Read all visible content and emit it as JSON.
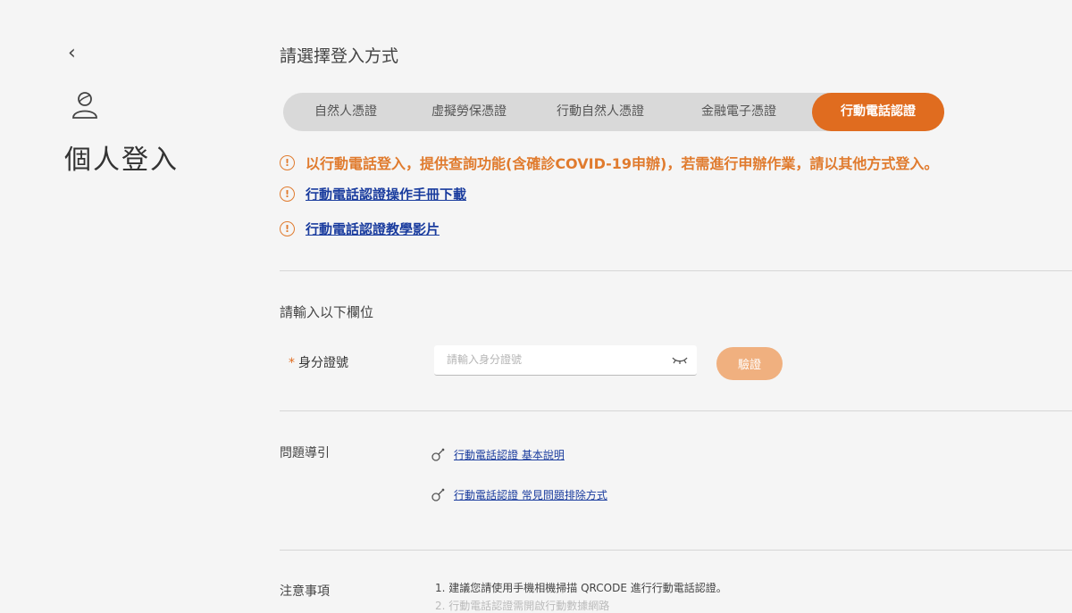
{
  "nav": {
    "back_symbol": "‹",
    "title": "個人登入"
  },
  "login": {
    "heading": "請選擇登入方式",
    "tabs": [
      {
        "label": "自然人憑證",
        "active": false
      },
      {
        "label": "虛擬勞保憑證",
        "active": false
      },
      {
        "label": "行動自然人憑證",
        "active": false
      },
      {
        "label": "金融電子憑證",
        "active": false
      },
      {
        "label": "行動電話認證",
        "active": true
      }
    ],
    "notices": [
      {
        "type": "text",
        "text": "以行動電話登入，提供查詢功能(含確診COVID-19申辦)，若需進行申辦作業，請以其他方式登入。"
      },
      {
        "type": "link",
        "text": "行動電話認證操作手冊下載"
      },
      {
        "type": "link",
        "text": "行動電話認證教學影片"
      }
    ]
  },
  "form": {
    "heading": "請輸入以下欄位",
    "required_mark": "*",
    "id_label": "身分證號",
    "id_value": "",
    "id_placeholder": "請輸入身分證號",
    "verify_label": "驗證"
  },
  "guide": {
    "label": "問題導引",
    "links": [
      "行動電話認證 基本說明",
      "行動電話認證 常見問題排除方式"
    ]
  },
  "notes": {
    "label": "注意事項",
    "items": [
      "1. 建議您請使用手機相機掃描 QRCODE 進行行動電話認證。",
      "2. 行動電話認證需開啟行動數據網路"
    ]
  },
  "colors": {
    "accent": "#e06c1f",
    "warning": "#e07b2e",
    "link": "#1a3c9e",
    "tab_bg": "#d9d9d9",
    "verify_btn": "#f0b07f"
  }
}
